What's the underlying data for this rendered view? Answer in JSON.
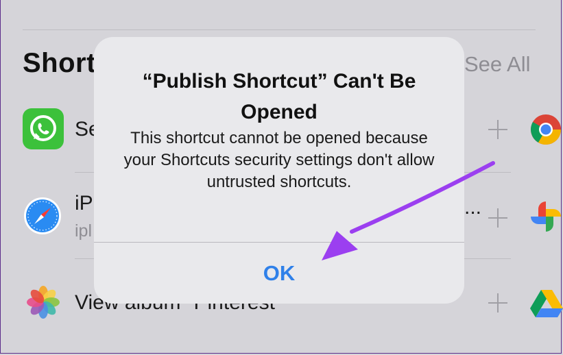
{
  "section": {
    "title": "Short",
    "see_all": "See All"
  },
  "rows": [
    {
      "title": "Se",
      "app_icon": "whatsapp-icon",
      "target_icon": "chrome-icon"
    },
    {
      "title": "iP",
      "subtitle": "ipl",
      "trailing": "...",
      "app_icon": "safari-icon",
      "target_icon": "google-photos-icon"
    },
    {
      "title": "View album \"Pinterest\"",
      "app_icon": "photos-icon",
      "target_icon": "google-drive-icon"
    }
  ],
  "alert": {
    "title": "“Publish Shortcut” Can't Be Opened",
    "message": "This shortcut cannot be opened because your Shortcuts security settings don't allow untrusted shortcuts.",
    "ok_label": "OK"
  },
  "colors": {
    "background": "#d5d4d9",
    "alert_background": "#e9e9ec",
    "accent_blue": "#2f80e9",
    "annotation_arrow": "#9b3ff0"
  },
  "annotation": {
    "icon": "annotation-arrow-icon"
  }
}
